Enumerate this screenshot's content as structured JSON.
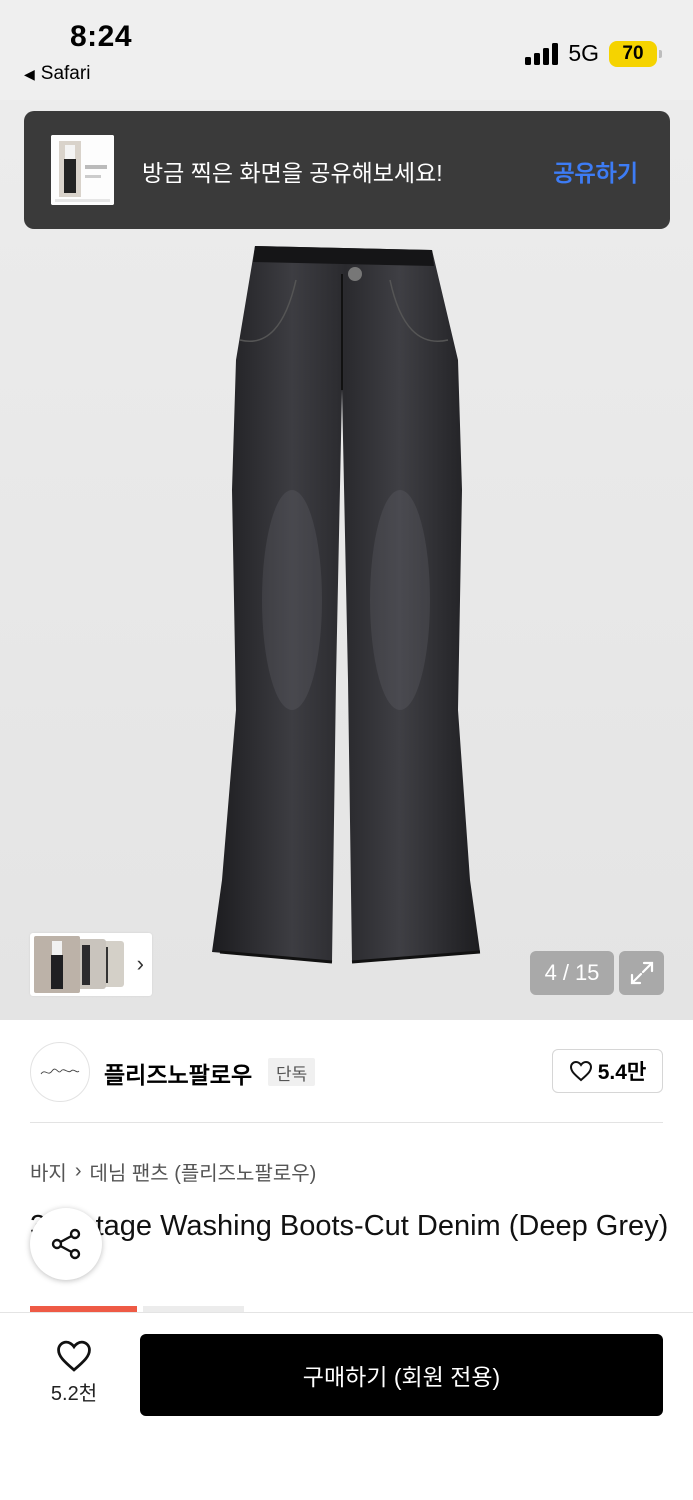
{
  "status_bar": {
    "time": "8:24",
    "back_app": "Safari",
    "back_icon": "back-triangle-icon",
    "network": "5G",
    "battery": "70"
  },
  "share_banner": {
    "message": "방금 찍은 화면을 공유해보세요!",
    "action": "공유하기",
    "link_color": "#3d7cf5"
  },
  "gallery": {
    "current": "4",
    "separator": "/",
    "total": "15",
    "expand_icon": "expand-icon"
  },
  "brand": {
    "name": "플리즈노팔로우",
    "tag": "단독",
    "likes": "5.4만"
  },
  "product": {
    "breadcrumb": [
      "바지",
      "데님 팬츠 (플리즈노팔로우)"
    ],
    "title": "3 Vintage Washing Boots-Cut Denim (Deep Grey)"
  },
  "bottom_bar": {
    "like_count": "5.2천",
    "buy_label": "구매하기 (회원 전용)"
  },
  "colors": {
    "accent_red": "#ee5a45",
    "battery_yellow": "#f5d300"
  }
}
